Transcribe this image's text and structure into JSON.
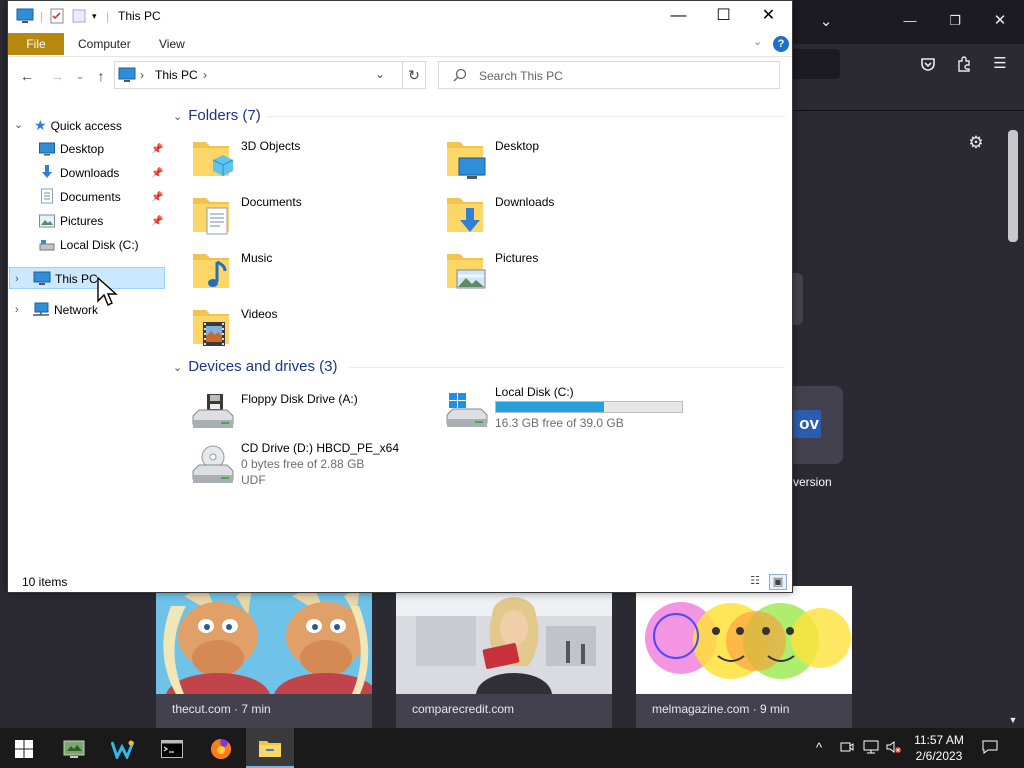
{
  "explorer": {
    "title": "This PC",
    "ribbon": {
      "file": "File",
      "computer": "Computer",
      "view": "View",
      "help": "?"
    },
    "address": {
      "location": "This PC",
      "sep1": "›",
      "sep2": "›"
    },
    "search": {
      "placeholder": "Search This PC"
    },
    "nav": {
      "quick_access": "Quick access",
      "items": [
        "Desktop",
        "Downloads",
        "Documents",
        "Pictures",
        "Local Disk (C:)"
      ],
      "this_pc": "This PC",
      "network": "Network"
    },
    "folders": {
      "header": "Folders (7)",
      "items": [
        "3D Objects",
        "Desktop",
        "Documents",
        "Downloads",
        "Music",
        "Pictures",
        "Videos"
      ]
    },
    "drives": {
      "header": "Devices and drives (3)",
      "floppy": {
        "name": "Floppy Disk Drive (A:)"
      },
      "local": {
        "name": "Local Disk (C:)",
        "free": "16.3 GB free of 39.0 GB",
        "used_fraction": 0.58
      },
      "cd": {
        "name": "CD Drive (D:) HBCD_PE_x64",
        "free": "0 bytes free of 2.88 GB",
        "fs": "UDF"
      }
    },
    "status": {
      "count": "10 items"
    }
  },
  "browser": {
    "stories": [
      {
        "source": "thecut.com · 7 min"
      },
      {
        "source": "comparecredit.com"
      },
      {
        "source": "melmagazine.com · 9 min"
      }
    ],
    "tile_text": "ov",
    "tile_label": "version"
  },
  "taskbar": {
    "time": "11:57 AM",
    "date": "2/6/2023"
  },
  "colors": {
    "accent": "#0078d7",
    "file_tab": "#b6880e",
    "selection": "#cce8ff",
    "capacity_fill": "#26a0da",
    "group_header": "#1e3287"
  }
}
